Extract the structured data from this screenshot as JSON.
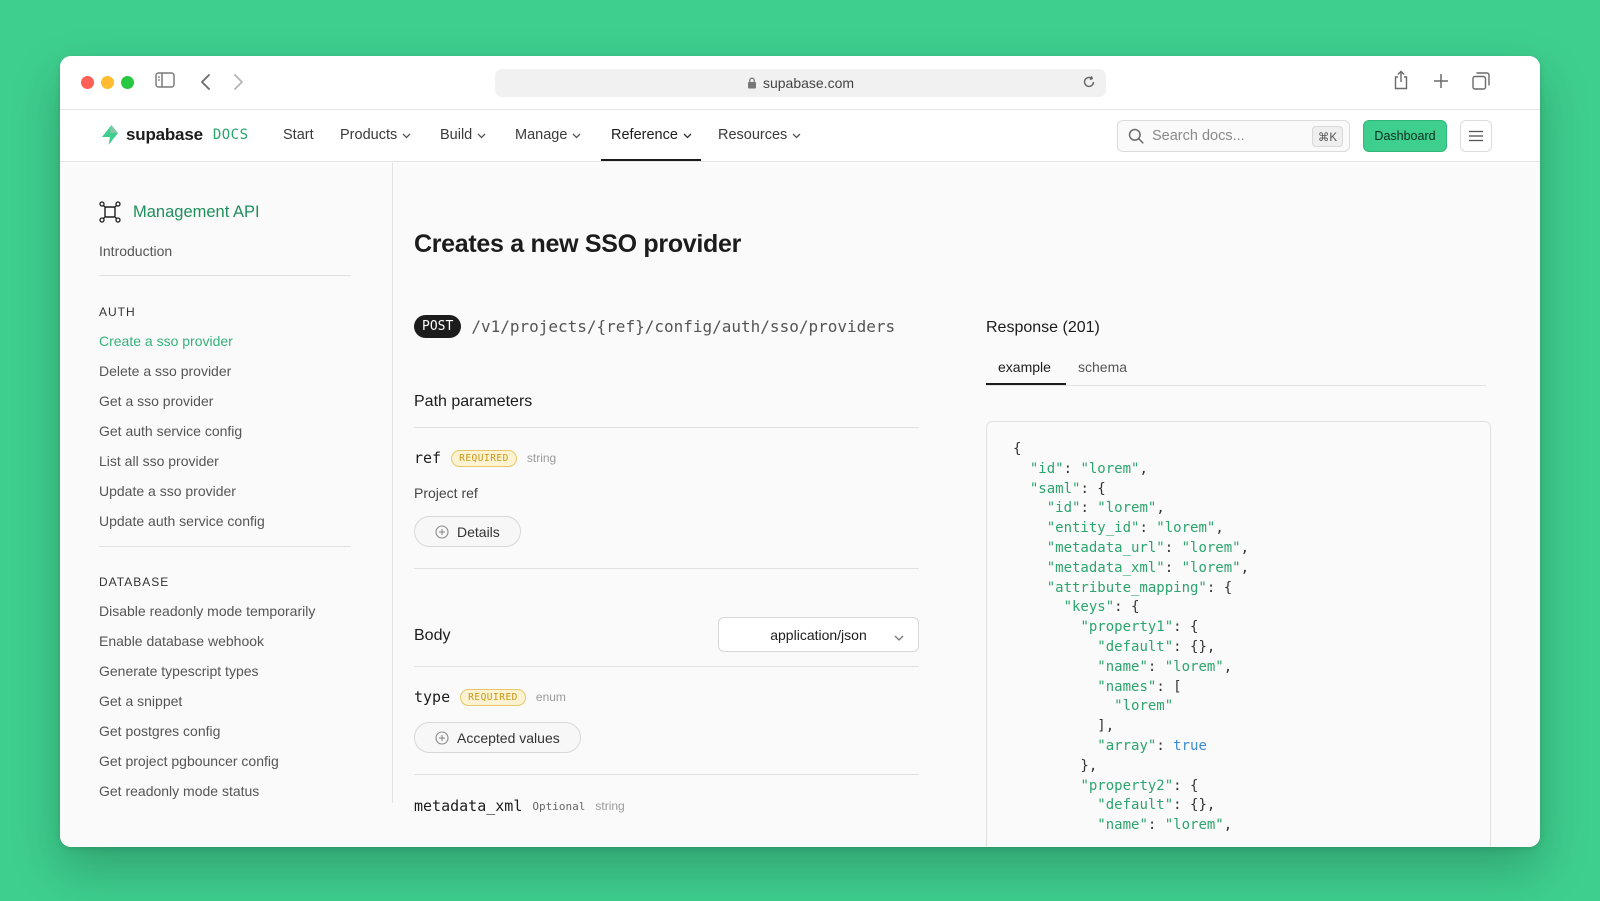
{
  "browser": {
    "url": "supabase.com"
  },
  "nav": {
    "logo_text": "supabase",
    "logo_docs": "DOCS",
    "items": [
      {
        "label": "Start",
        "has_menu": false
      },
      {
        "label": "Products",
        "has_menu": true
      },
      {
        "label": "Build",
        "has_menu": true
      },
      {
        "label": "Manage",
        "has_menu": true
      },
      {
        "label": "Reference",
        "has_menu": true,
        "active": true
      },
      {
        "label": "Resources",
        "has_menu": true
      }
    ],
    "search_placeholder": "Search docs...",
    "search_shortcut": "⌘K",
    "dashboard_label": "Dashboard"
  },
  "sidebar": {
    "title": "Management API",
    "intro": "Introduction",
    "sections": [
      {
        "heading": "AUTH",
        "items": [
          "Create a sso provider",
          "Delete a sso provider",
          "Get a sso provider",
          "Get auth service config",
          "List all sso provider",
          "Update a sso provider",
          "Update auth service config"
        ]
      },
      {
        "heading": "DATABASE",
        "items": [
          "Disable readonly mode temporarily",
          "Enable database webhook",
          "Generate typescript types",
          "Get a snippet",
          "Get postgres config",
          "Get project pgbouncer config",
          "Get readonly mode status"
        ]
      }
    ],
    "active_item": "Create a sso provider"
  },
  "main": {
    "title": "Creates a new SSO provider",
    "method": "POST",
    "path": "/v1/projects/{ref}/config/auth/sso/providers",
    "path_params_title": "Path parameters",
    "params": [
      {
        "name": "ref",
        "badge": "REQUIRED",
        "type": "string",
        "description": "Project ref",
        "button": "Details"
      }
    ],
    "body_title": "Body",
    "content_type": "application/json",
    "body_params": [
      {
        "name": "type",
        "badge": "REQUIRED",
        "type": "enum",
        "button": "Accepted values"
      },
      {
        "name": "metadata_xml",
        "badge": "Optional",
        "type": "string"
      }
    ]
  },
  "response": {
    "title": "Response (201)",
    "tabs": [
      "example",
      "schema"
    ],
    "active_tab": "example",
    "code_lines": [
      "{",
      "  \"id\": \"lorem\",",
      "  \"saml\": {",
      "    \"id\": \"lorem\",",
      "    \"entity_id\": \"lorem\",",
      "    \"metadata_url\": \"lorem\",",
      "    \"metadata_xml\": \"lorem\",",
      "    \"attribute_mapping\": {",
      "      \"keys\": {",
      "        \"property1\": {",
      "          \"default\": {},",
      "          \"name\": \"lorem\",",
      "          \"names\": [",
      "            \"lorem\"",
      "          ],",
      "          \"array\": true",
      "        },",
      "        \"property2\": {",
      "          \"default\": {},",
      "          \"name\": \"lorem\","
    ]
  },
  "colors": {
    "brand": "#3ecf8e",
    "brand_dark": "#1f8f5c",
    "required": "#c79615"
  }
}
